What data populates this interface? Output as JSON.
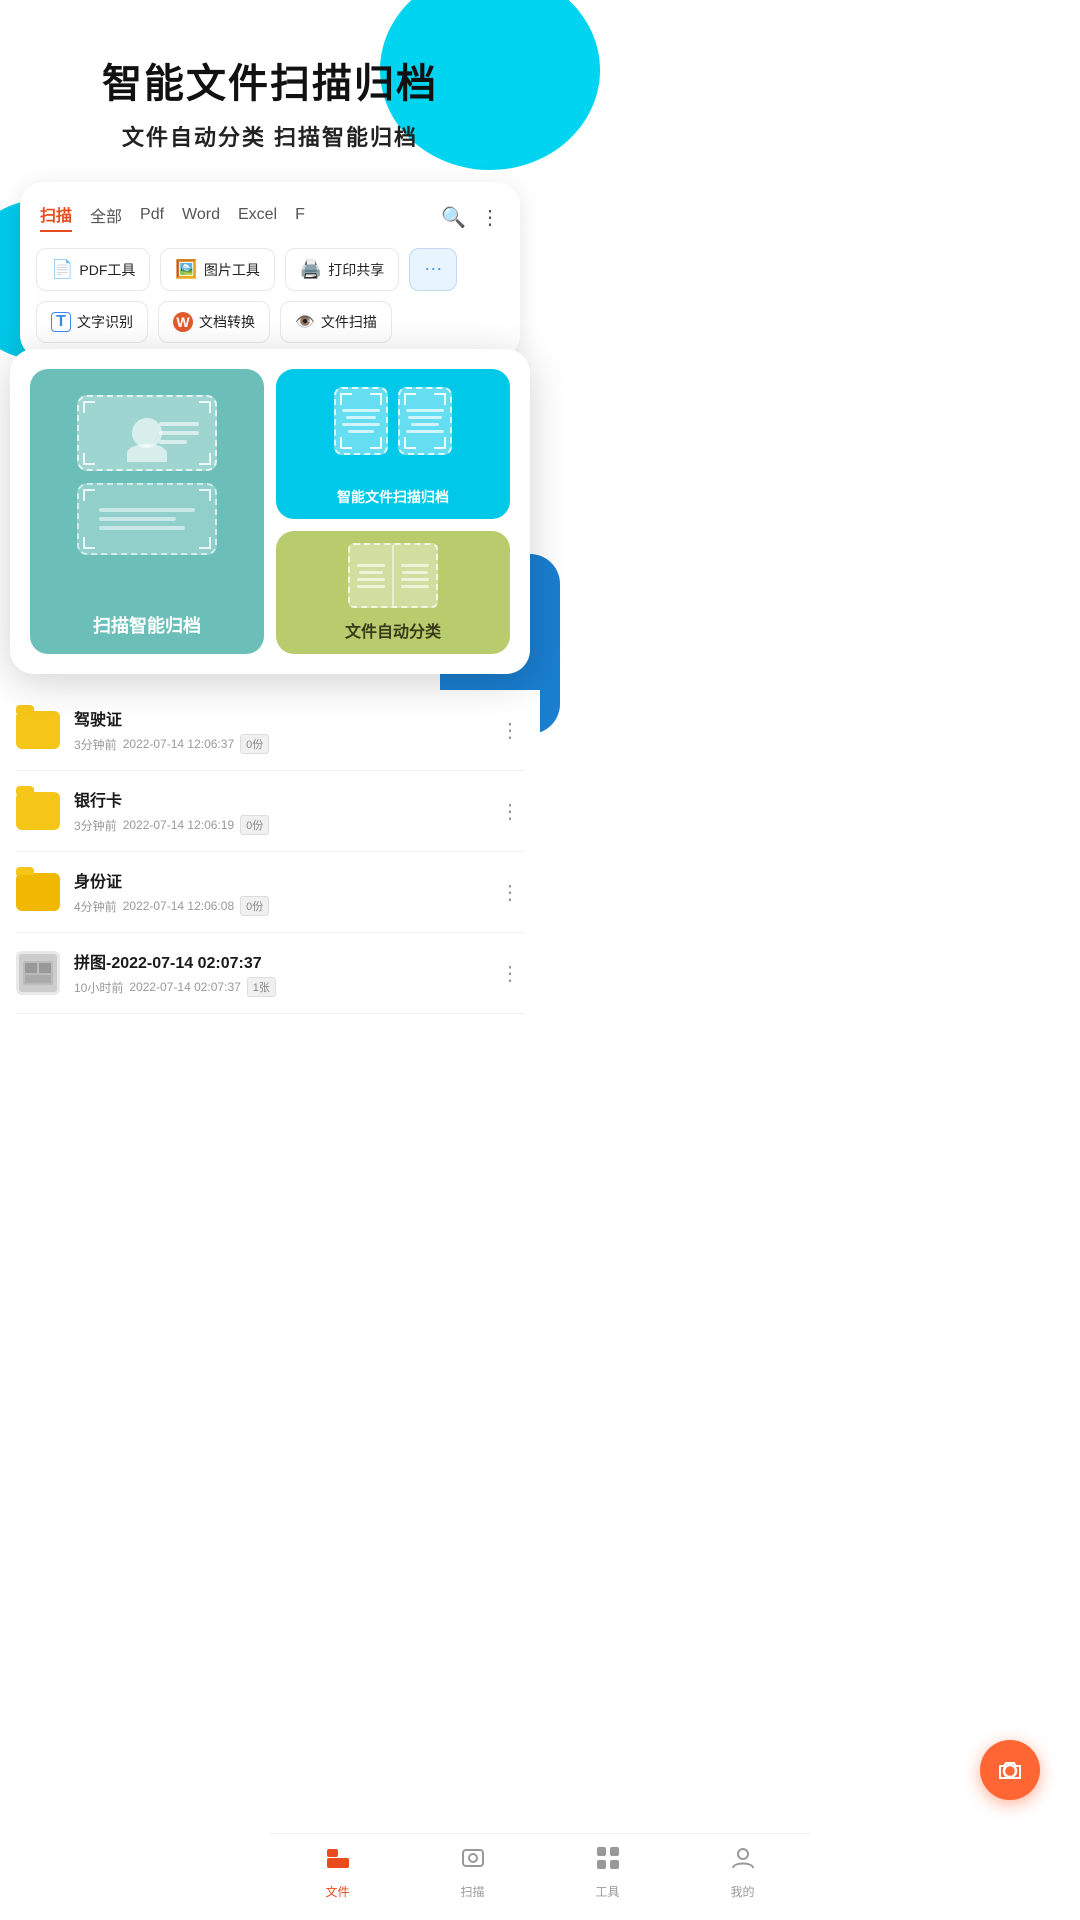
{
  "header": {
    "title": "智能文件扫描归档",
    "subtitle": "文件自动分类   扫描智能归档"
  },
  "tabs": {
    "items": [
      {
        "label": "扫描",
        "active": true
      },
      {
        "label": "全部",
        "active": false
      },
      {
        "label": "Pdf",
        "active": false
      },
      {
        "label": "Word",
        "active": false
      },
      {
        "label": "Excel",
        "active": false
      },
      {
        "label": "F",
        "active": false
      }
    ]
  },
  "tools": [
    {
      "icon": "📄",
      "label": "PDF工具"
    },
    {
      "icon": "🖼️",
      "label": "图片工具"
    },
    {
      "icon": "🖨️",
      "label": "打印共享"
    }
  ],
  "ocr_tools": [
    {
      "icon": "T",
      "label": "文字识别"
    },
    {
      "icon": "W",
      "label": "文档转换"
    },
    {
      "icon": "👁️",
      "label": "文件扫描"
    }
  ],
  "popup": {
    "left_label": "扫描智能归档",
    "top_right_label": "智能文件扫描归档",
    "bottom_right_label": "文件自动分类"
  },
  "file_list": [
    {
      "name": "驾驶证",
      "time": "3分钟前",
      "date": "2022-07-14 12:06:37",
      "badge": "0份",
      "type": "folder"
    },
    {
      "name": "银行卡",
      "time": "3分钟前",
      "date": "2022-07-14 12:06:19",
      "badge": "0份",
      "type": "folder"
    },
    {
      "name": "身份证",
      "time": "4分钟前",
      "date": "2022-07-14 12:06:08",
      "badge": "0份",
      "type": "folder"
    },
    {
      "name": "拼图-2022-07-14 02:07:37",
      "time": "10小时前",
      "date": "2022-07-14 02:07:37",
      "badge": "1张",
      "type": "image"
    }
  ],
  "bottom_tabs": [
    {
      "label": "文件",
      "active": true
    },
    {
      "label": "扫描",
      "active": false
    },
    {
      "label": "工具",
      "active": false
    },
    {
      "label": "我的",
      "active": false
    }
  ]
}
